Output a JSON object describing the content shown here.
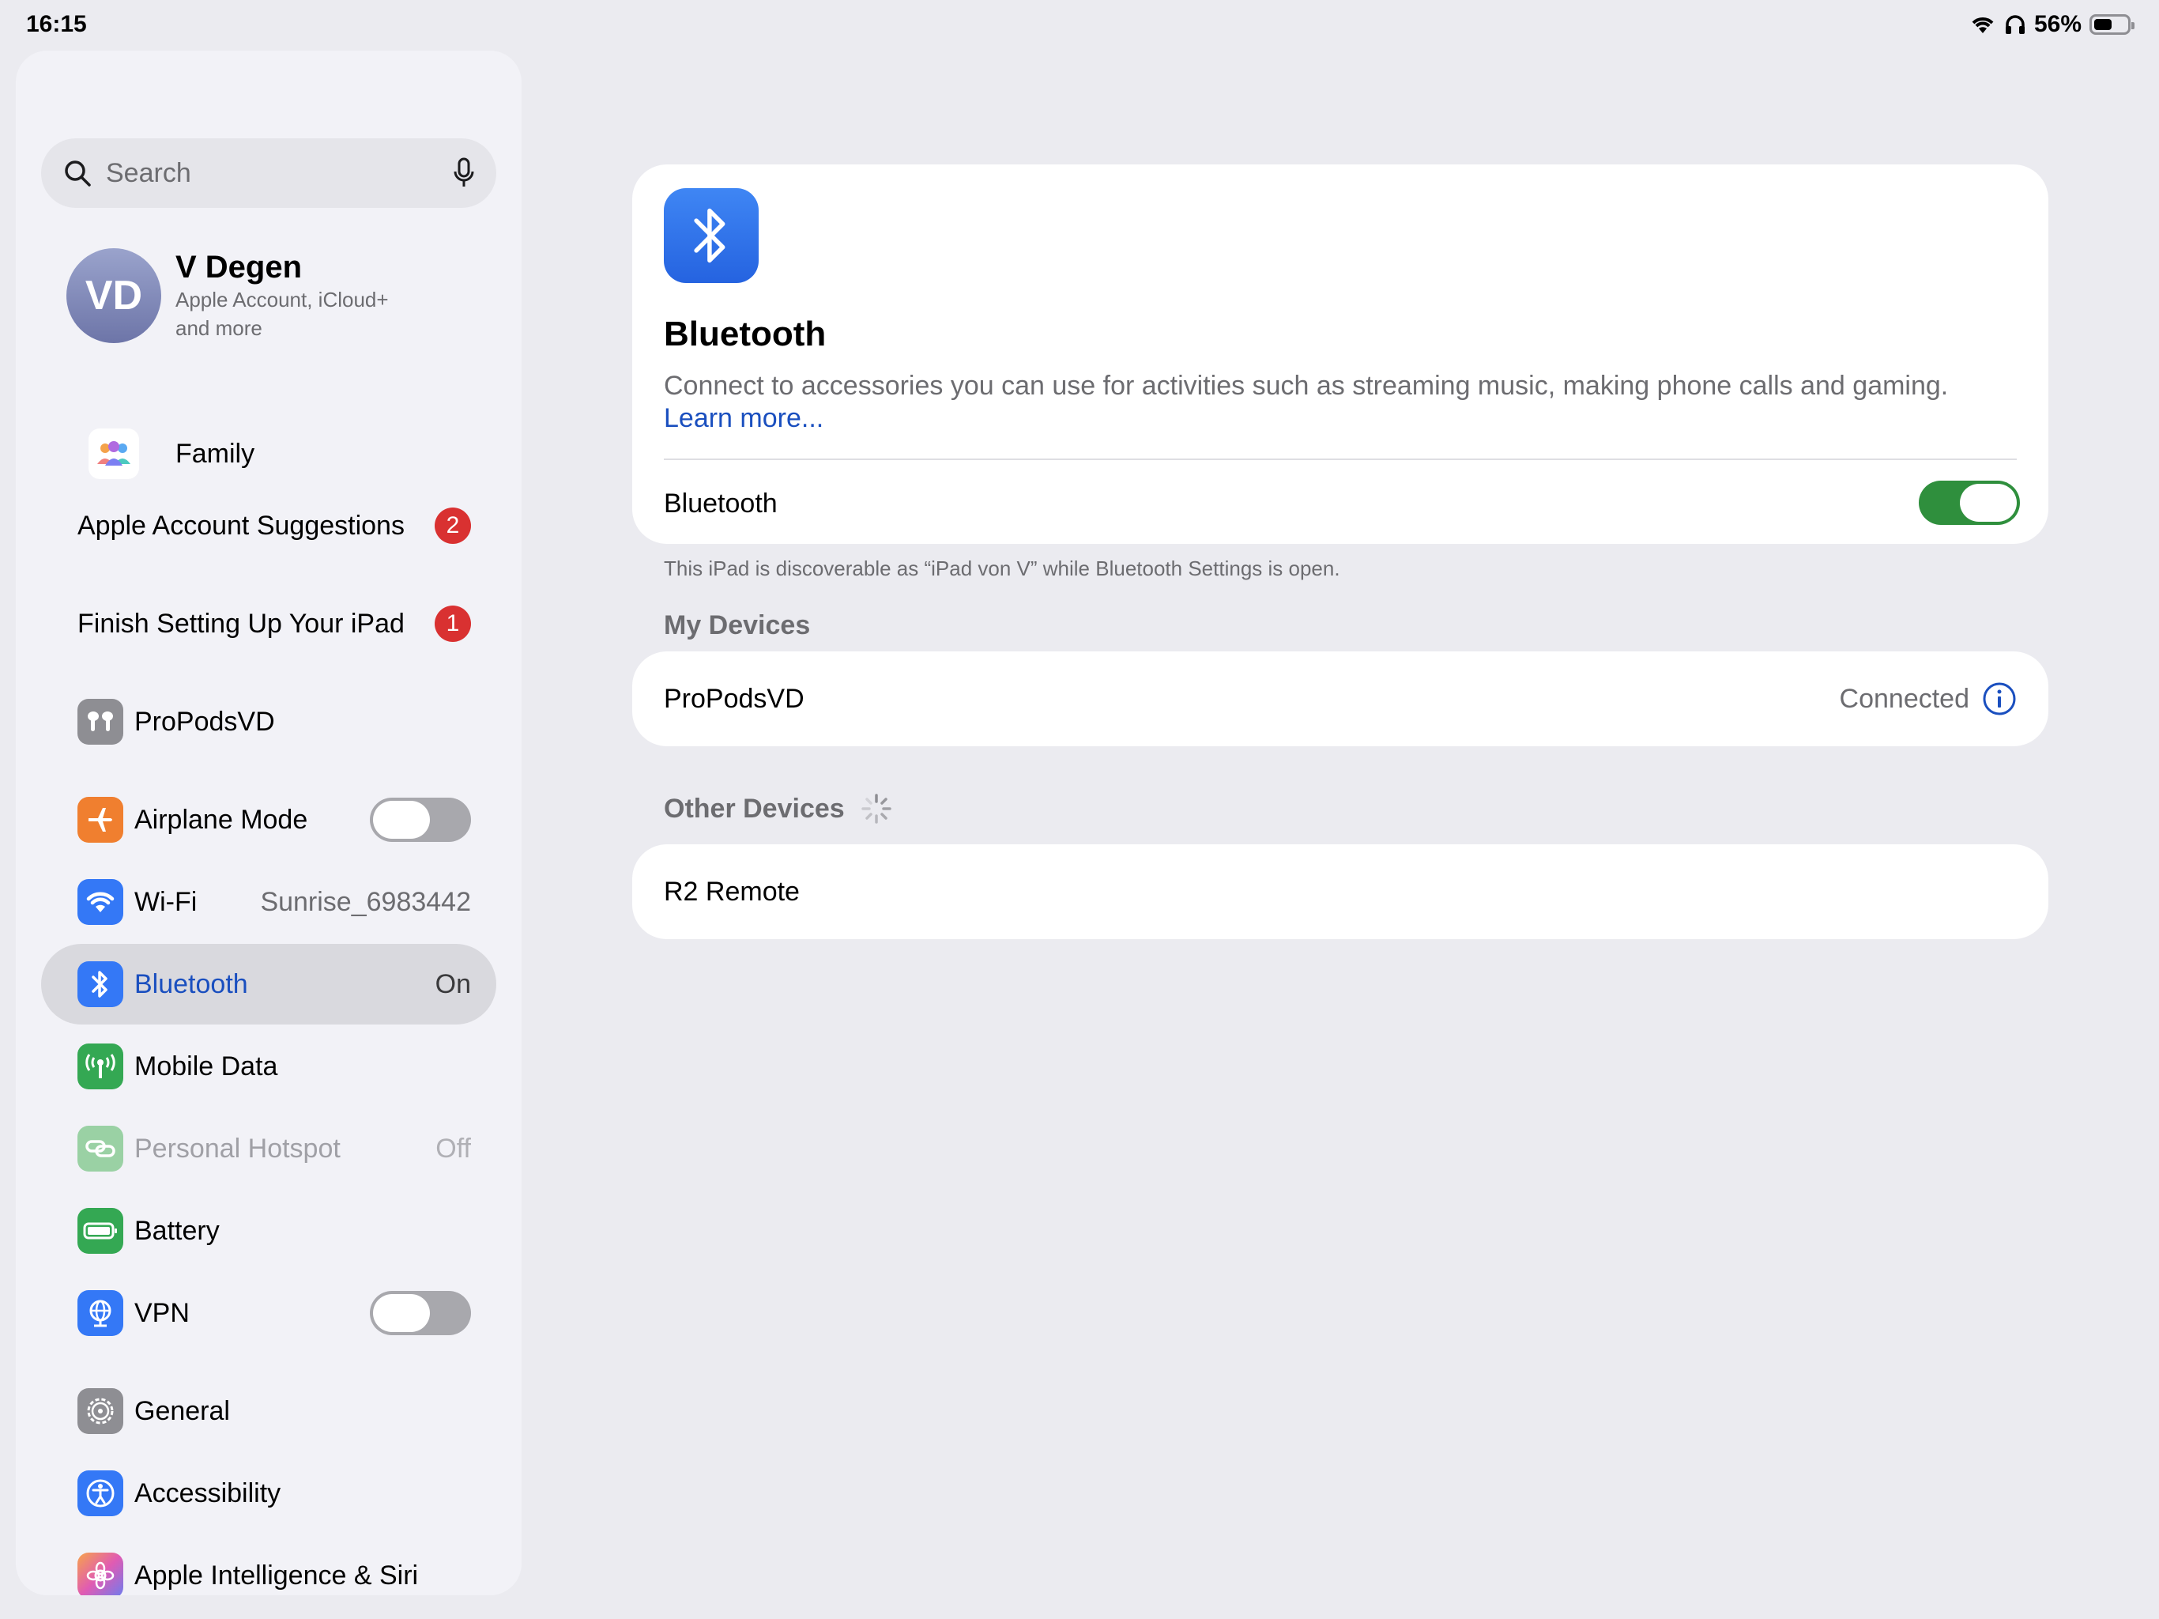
{
  "status_bar": {
    "time": "16:15",
    "battery": "56%",
    "battery_level": 0.56
  },
  "sidebar": {
    "search_placeholder": "Search",
    "profile": {
      "initials": "VD",
      "name": "V Degen",
      "subtitle": "Apple Account, iCloud+ and more"
    },
    "family_label": "Family",
    "suggestions": [
      {
        "label": "Apple Account Suggestions",
        "badge": "2"
      },
      {
        "label": "Finish Setting Up Your iPad",
        "badge": "1"
      }
    ],
    "items": [
      {
        "label": "ProPodsVD",
        "icon": "airpods-icon",
        "color": "#8e8e93"
      },
      {
        "label": "Airplane Mode",
        "icon": "airplane-icon",
        "color": "#f07f2f",
        "toggle": false
      },
      {
        "label": "Wi-Fi",
        "icon": "wifi-icon",
        "color": "#3478f6",
        "value": "Sunrise_6983442"
      },
      {
        "label": "Bluetooth",
        "icon": "bluetooth-icon",
        "color": "#3478f6",
        "value": "On"
      },
      {
        "label": "Mobile Data",
        "icon": "antenna-icon",
        "color": "#34a853"
      },
      {
        "label": "Personal Hotspot",
        "icon": "hotspot-icon",
        "color": "#9ad1a4",
        "value": "Off"
      },
      {
        "label": "Battery",
        "icon": "battery-icon",
        "color": "#34a853"
      },
      {
        "label": "VPN",
        "icon": "vpn-globe-icon",
        "color": "#3478f6",
        "toggle": false
      },
      {
        "label": "General",
        "icon": "gear-icon",
        "color": "#8e8e93"
      },
      {
        "label": "Accessibility",
        "icon": "accessibility-icon",
        "color": "#3478f6"
      },
      {
        "label": "Apple Intelligence & Siri",
        "icon": "siri-icon",
        "color": "#c86dd7"
      }
    ]
  },
  "detail": {
    "title": "Bluetooth",
    "description": "Connect to accessories you can use for activities such as streaming music, making phone calls and gaming.",
    "learn_more": "Learn more...",
    "toggle_label": "Bluetooth",
    "toggle_on": true,
    "footnote": "This iPad is discoverable as “iPad von V” while Bluetooth Settings is open.",
    "my_devices_header": "My Devices",
    "my_devices": [
      {
        "name": "ProPodsVD",
        "status": "Connected"
      }
    ],
    "other_devices_header": "Other Devices",
    "other_devices": [
      {
        "name": "R2 Remote"
      }
    ]
  }
}
